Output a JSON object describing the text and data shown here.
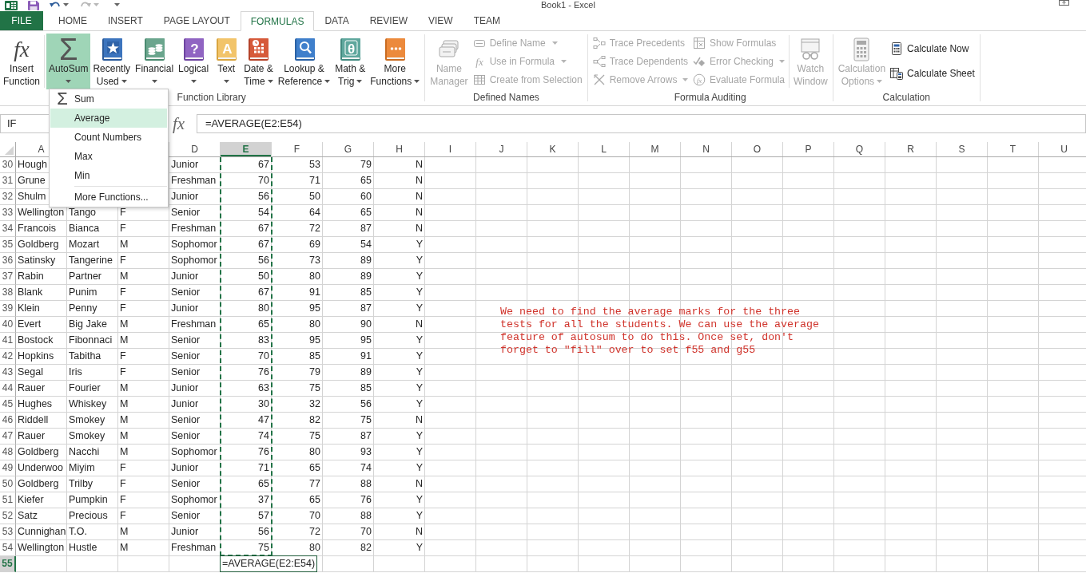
{
  "window": {
    "title": "Book1 - Excel"
  },
  "ribbon_tabs": [
    {
      "label": "FILE",
      "kind": "backstage",
      "selected": false
    },
    {
      "label": "HOME",
      "kind": "tab",
      "selected": false
    },
    {
      "label": "INSERT",
      "kind": "tab",
      "selected": false
    },
    {
      "label": "PAGE LAYOUT",
      "kind": "tab",
      "selected": false
    },
    {
      "label": "FORMULAS",
      "kind": "tab",
      "selected": true
    },
    {
      "label": "DATA",
      "kind": "tab",
      "selected": false
    },
    {
      "label": "REVIEW",
      "kind": "tab",
      "selected": false
    },
    {
      "label": "VIEW",
      "kind": "tab",
      "selected": false
    },
    {
      "label": "TEAM",
      "kind": "tab",
      "selected": false
    }
  ],
  "ribbon_groups": [
    {
      "label": "Function Library",
      "items": [
        {
          "kind": "large",
          "lines": [
            "Insert",
            "Function"
          ],
          "icon_text": "fx",
          "dropdown": false,
          "expanded": false,
          "disabled": false
        },
        {
          "kind": "separator"
        },
        {
          "kind": "large",
          "lines": [
            "AutoSum"
          ],
          "icon_text": "Σ",
          "dropdown": true,
          "expanded": true,
          "disabled": false
        },
        {
          "kind": "large",
          "lines": [
            "Recently",
            "Used"
          ],
          "dropdown": true,
          "expanded": false,
          "disabled": false
        },
        {
          "kind": "large",
          "lines": [
            "Financial"
          ],
          "dropdown": true,
          "expanded": false,
          "disabled": false
        },
        {
          "kind": "large",
          "lines": [
            "Logical"
          ],
          "icon_text": "?",
          "dropdown": true,
          "expanded": false,
          "disabled": false
        },
        {
          "kind": "large",
          "lines": [
            "Text"
          ],
          "icon_text": "A",
          "dropdown": true,
          "expanded": false,
          "disabled": false
        },
        {
          "kind": "large",
          "lines": [
            "Date &",
            "Time"
          ],
          "dropdown": true,
          "expanded": false,
          "disabled": false
        },
        {
          "kind": "large",
          "lines": [
            "Lookup &",
            "Reference"
          ],
          "dropdown": true,
          "expanded": false,
          "disabled": false
        },
        {
          "kind": "large",
          "lines": [
            "Math &",
            "Trig"
          ],
          "icon_text": "θ",
          "dropdown": true,
          "expanded": false,
          "disabled": false
        },
        {
          "kind": "large",
          "lines": [
            "More",
            "Functions"
          ],
          "dropdown": true,
          "expanded": false,
          "disabled": false
        }
      ]
    },
    {
      "label": "Defined Names",
      "items": [
        {
          "kind": "large",
          "lines": [
            "Name",
            "Manager"
          ],
          "dropdown": false,
          "disabled": true
        },
        {
          "kind": "stack",
          "buttons": [
            {
              "label": "Define Name",
              "dropdown": true,
              "disabled": true
            },
            {
              "label": "Use in Formula",
              "icon_text": "fx",
              "dropdown": true,
              "disabled": true
            },
            {
              "label": "Create from Selection",
              "dropdown": false,
              "disabled": true
            }
          ]
        }
      ]
    },
    {
      "label": "Formula Auditing",
      "items": [
        {
          "kind": "stack",
          "buttons": [
            {
              "label": "Trace Precedents",
              "dropdown": false,
              "disabled": true
            },
            {
              "label": "Trace Dependents",
              "dropdown": false,
              "disabled": true
            },
            {
              "label": "Remove Arrows",
              "dropdown": true,
              "split": true,
              "disabled": true
            }
          ]
        },
        {
          "kind": "stack",
          "buttons": [
            {
              "label": "Show Formulas",
              "dropdown": false,
              "disabled": true
            },
            {
              "label": "Error Checking",
              "dropdown": true,
              "split": true,
              "disabled": true
            },
            {
              "label": "Evaluate Formula",
              "icon_text": "fx",
              "dropdown": false,
              "disabled": true
            }
          ]
        },
        {
          "kind": "separator"
        },
        {
          "kind": "large",
          "lines": [
            "Watch",
            "Window"
          ],
          "dropdown": false,
          "disabled": true
        }
      ]
    },
    {
      "label": "Calculation",
      "items": [
        {
          "kind": "large",
          "lines": [
            "Calculation",
            "Options"
          ],
          "dropdown": true,
          "disabled": true
        },
        {
          "kind": "stack",
          "buttons": [
            {
              "label": "Calculate Now",
              "dropdown": false,
              "disabled": false
            },
            {
              "label": "Calculate Sheet",
              "dropdown": false,
              "disabled": false
            }
          ]
        }
      ]
    }
  ],
  "autosum_menu": {
    "items": [
      {
        "kind": "item",
        "label": "Sum",
        "icon_text": "Σ",
        "selected": false
      },
      {
        "kind": "item",
        "label": "Average",
        "selected": true
      },
      {
        "kind": "item",
        "label": "Count Numbers",
        "selected": false
      },
      {
        "kind": "item",
        "label": "Max",
        "selected": false
      },
      {
        "kind": "item",
        "label": "Min",
        "selected": false
      },
      {
        "kind": "separator"
      },
      {
        "kind": "item",
        "label": "More Functions...",
        "selected": false
      }
    ]
  },
  "formula_bar": {
    "name_box": "IF",
    "fx": "fx",
    "formula": "=AVERAGE(E2:E54)"
  },
  "sheet": {
    "columns": [
      {
        "label": "A",
        "selected": false,
        "marquee": false
      },
      null,
      null,
      {
        "label": "D",
        "selected": false,
        "marquee": false
      },
      {
        "label": "E",
        "selected": true,
        "marquee": true
      },
      {
        "label": "F",
        "selected": false,
        "marquee": false
      },
      {
        "label": "G",
        "selected": false,
        "marquee": false
      },
      {
        "label": "H",
        "selected": false,
        "marquee": false
      },
      {
        "label": "I",
        "selected": false,
        "marquee": false
      },
      {
        "label": "J",
        "selected": false,
        "marquee": false
      },
      {
        "label": "K",
        "selected": false,
        "marquee": false
      },
      {
        "label": "L",
        "selected": false,
        "marquee": false
      },
      {
        "label": "M",
        "selected": false,
        "marquee": false
      },
      {
        "label": "N",
        "selected": false,
        "marquee": false
      },
      {
        "label": "O",
        "selected": false,
        "marquee": false
      },
      {
        "label": "P",
        "selected": false,
        "marquee": false
      },
      {
        "label": "Q",
        "selected": false,
        "marquee": false
      },
      {
        "label": "R",
        "selected": false,
        "marquee": false
      },
      {
        "label": "S",
        "selected": false,
        "marquee": false
      },
      {
        "label": "T",
        "selected": false,
        "marquee": false
      },
      {
        "label": "U",
        "selected": false,
        "marquee": false
      }
    ],
    "rows": [
      {
        "header": "30",
        "selected": false,
        "cells": [
          "Hough",
          null,
          null,
          "Junior",
          "67",
          "53",
          "79",
          "N"
        ]
      },
      {
        "header": "31",
        "selected": false,
        "cells": [
          "Grune",
          null,
          null,
          "Freshman",
          "70",
          "71",
          "65",
          "N"
        ]
      },
      {
        "header": "32",
        "selected": false,
        "cells": [
          "Shulm",
          null,
          null,
          "Junior",
          "56",
          "50",
          "60",
          "N"
        ]
      },
      {
        "header": "33",
        "selected": false,
        "cells": [
          "Wellington",
          "Tango",
          "F",
          "Senior",
          "54",
          "64",
          "65",
          "N"
        ]
      },
      {
        "header": "34",
        "selected": false,
        "cells": [
          "Francois",
          "Bianca",
          "F",
          "Freshman",
          "67",
          "72",
          "87",
          "N"
        ]
      },
      {
        "header": "35",
        "selected": false,
        "cells": [
          "Goldberg",
          "Mozart",
          "M",
          "Sophomor",
          "67",
          "69",
          "54",
          "Y"
        ]
      },
      {
        "header": "36",
        "selected": false,
        "cells": [
          "Satinsky",
          "Tangerine",
          "F",
          "Sophomor",
          "56",
          "73",
          "89",
          "Y"
        ]
      },
      {
        "header": "37",
        "selected": false,
        "cells": [
          "Rabin",
          "Partner",
          "M",
          "Junior",
          "50",
          "80",
          "89",
          "Y"
        ]
      },
      {
        "header": "38",
        "selected": false,
        "cells": [
          "Blank",
          "Punim",
          "F",
          "Senior",
          "67",
          "91",
          "85",
          "Y"
        ]
      },
      {
        "header": "39",
        "selected": false,
        "cells": [
          "Klein",
          "Penny",
          "F",
          "Junior",
          "80",
          "95",
          "87",
          "Y"
        ]
      },
      {
        "header": "40",
        "selected": false,
        "cells": [
          "Evert",
          "Big Jake",
          "M",
          "Freshman",
          "65",
          "80",
          "90",
          "N"
        ]
      },
      {
        "header": "41",
        "selected": false,
        "cells": [
          "Bostock",
          "Fibonnaci",
          "M",
          "Senior",
          "83",
          "95",
          "95",
          "Y"
        ]
      },
      {
        "header": "42",
        "selected": false,
        "cells": [
          "Hopkins",
          "Tabitha",
          "F",
          "Senior",
          "70",
          "85",
          "91",
          "Y"
        ]
      },
      {
        "header": "43",
        "selected": false,
        "cells": [
          "Segal",
          "Iris",
          "F",
          "Senior",
          "76",
          "79",
          "89",
          "Y"
        ]
      },
      {
        "header": "44",
        "selected": false,
        "cells": [
          "Rauer",
          "Fourier",
          "M",
          "Junior",
          "63",
          "75",
          "85",
          "Y"
        ]
      },
      {
        "header": "45",
        "selected": false,
        "cells": [
          "Hughes",
          "Whiskey",
          "M",
          "Junior",
          "30",
          "32",
          "56",
          "Y"
        ]
      },
      {
        "header": "46",
        "selected": false,
        "cells": [
          "Riddell",
          "Smokey",
          "M",
          "Senior",
          "47",
          "82",
          "75",
          "N"
        ]
      },
      {
        "header": "47",
        "selected": false,
        "cells": [
          "Rauer",
          "Smokey",
          "M",
          "Senior",
          "74",
          "75",
          "87",
          "Y"
        ]
      },
      {
        "header": "48",
        "selected": false,
        "cells": [
          "Goldberg",
          "Nacchi",
          "M",
          "Sophomor",
          "76",
          "80",
          "93",
          "Y"
        ]
      },
      {
        "header": "49",
        "selected": false,
        "cells": [
          "Underwoo",
          "Miyim",
          "F",
          "Junior",
          "71",
          "65",
          "74",
          "Y"
        ]
      },
      {
        "header": "50",
        "selected": false,
        "cells": [
          "Goldberg",
          "Trilby",
          "F",
          "Senior",
          "65",
          "77",
          "88",
          "N"
        ]
      },
      {
        "header": "51",
        "selected": false,
        "cells": [
          "Kiefer",
          "Pumpkin",
          "F",
          "Sophomor",
          "37",
          "65",
          "76",
          "Y"
        ]
      },
      {
        "header": "52",
        "selected": false,
        "cells": [
          "Satz",
          "Precious",
          "F",
          "Senior",
          "57",
          "70",
          "88",
          "Y"
        ]
      },
      {
        "header": "53",
        "selected": false,
        "cells": [
          "Cunnighan",
          "T.O.",
          "M",
          "Junior",
          "56",
          "72",
          "70",
          "N"
        ]
      },
      {
        "header": "54",
        "selected": false,
        "cells": [
          "Wellington",
          "Hustle",
          "M",
          "Freshman",
          "75",
          "80",
          "82",
          "Y"
        ]
      },
      {
        "header": "55",
        "selected": true,
        "cells": [
          null,
          null,
          null,
          null,
          {
            "text": "=AVERAGE(E2:E54)",
            "editing": true
          }
        ]
      }
    ],
    "text_box": {
      "text": "We need to find the average marks for the three tests for all the students. We can use the average feature of autosum to do this. Once set, don't forget to \"fill\" over to set f55 and g55"
    }
  }
}
